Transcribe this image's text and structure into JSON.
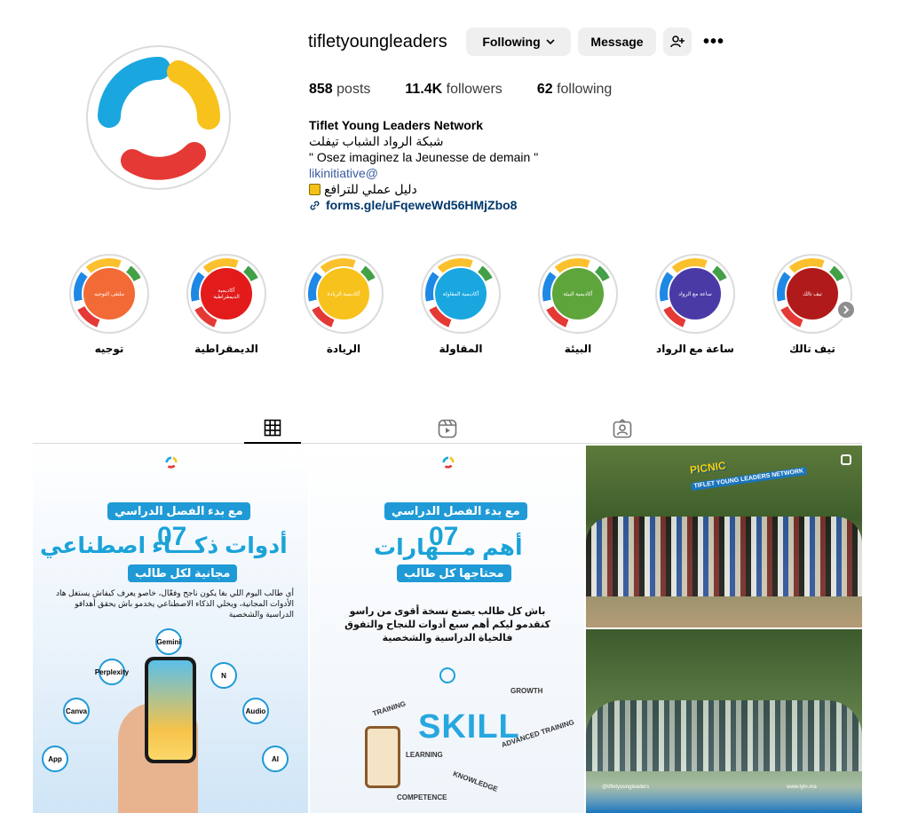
{
  "profile": {
    "username": "tifletyoungleaders",
    "following_label": "Following",
    "message_label": "Message",
    "more_label": "•••",
    "stats": {
      "posts_count": "858",
      "posts_label": "posts",
      "followers_count": "11.4K",
      "followers_label": "followers",
      "following_count": "62",
      "following_label": "following"
    },
    "bio": {
      "name": "Tiflet Young Leaders Network",
      "line_ar": "شبكة الرواد الشباب تيفلت",
      "quote": "\" Osez imaginez la Jeunesse de demain \"",
      "mention": "likinitiative@",
      "guide": "دليل عملي للترافع",
      "link": "forms.gle/uFqeweWd56HMjZbo8"
    }
  },
  "highlights": [
    {
      "label": "توجيه",
      "inner": "ملتقى التوجيه",
      "color": "#f26a36"
    },
    {
      "label": "الديمقراطية",
      "inner": "أكاديمية الديمقراطية",
      "color": "#e31b1b"
    },
    {
      "label": "الريادة",
      "inner": "أكاديمية الريادة",
      "color": "#f7c21c"
    },
    {
      "label": "المقاولة",
      "inner": "أكاديمية المقاولة",
      "color": "#1aa7e0"
    },
    {
      "label": "البيئة",
      "inner": "أكاديمية البيئة",
      "color": "#5ea53b"
    },
    {
      "label": "ساعة مع الرواد",
      "inner": "ساعة مع الرواد",
      "color": "#4a3aa6"
    },
    {
      "label": "تيف تالك",
      "inner": "تيف تالك",
      "color": "#b11a1a"
    }
  ],
  "tabs": {
    "posts_icon": "grid-icon",
    "reels_icon": "reels-icon",
    "tagged_icon": "tagged-icon"
  },
  "posts": {
    "p1": {
      "pill_top": "مع بدء الفصل الدراسي",
      "number": "07",
      "headline": "أدوات ذكـــاء اصطناعي",
      "pill_bottom": "مجانية لكل طالب",
      "body": "أي طالب اليوم اللي بغا يكون ناجح وفعّال، خاصو يعرف كيفاش يستغل هاد الأدوات المجانية، ويخلي الذكاء الاصطناعي يخدمو باش يحقق أهدافو الدراسية والشخصية",
      "tools": [
        "Gemini",
        "Perplexity",
        "N",
        "Canva",
        "Audio",
        "App",
        "AI"
      ]
    },
    "p2": {
      "pill_top": "مع بدء الفصل الدراسي",
      "number": "07",
      "headline": "أهم مـــهارات",
      "pill_bottom": "محتاجها كل طالب",
      "body": "باش كل طالب يصنع نسخة أقوى من راسو كنقدمو ليكم أهم سبع أدوات للنجاح والتفوق فالحياة الدراسية والشخصية",
      "skill": "SKILL",
      "words": [
        "TRAINING",
        "LEARNING",
        "KNOWLEDGE",
        "COMPETENCE",
        "ADVANCED TRAINING",
        "GROWTH"
      ]
    },
    "p3": {
      "title": "PICNIC",
      "subtitle": "TIFLET YOUNG LEADERS NETWORK"
    },
    "p4": {
      "handle": "@tifletyoungleaders",
      "site": "www.tyln.ma"
    }
  }
}
